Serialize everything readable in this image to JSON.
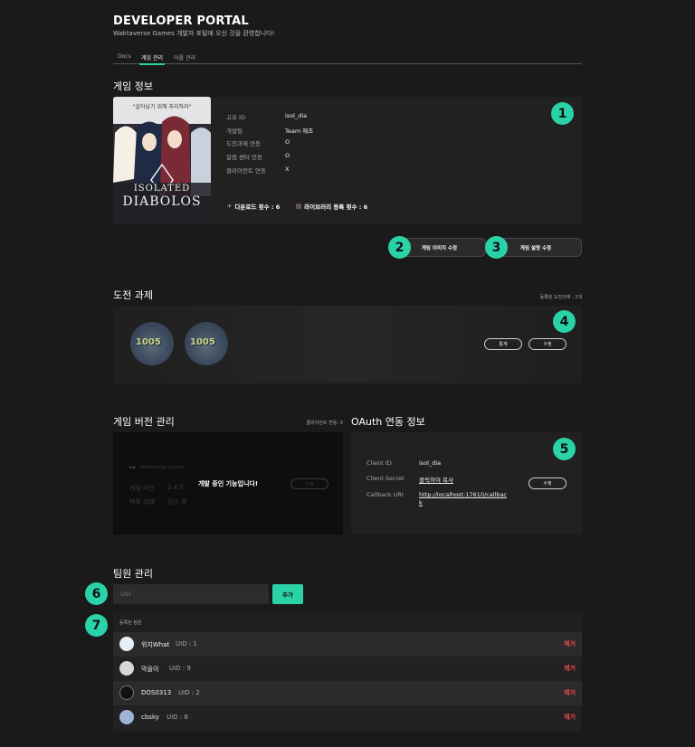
{
  "header": {
    "title": "DEVELOPER PORTAL",
    "subtitle": "Waktaverse Games 개발자 포털에 오신 것을 환영합니다!"
  },
  "tabs": [
    {
      "label": "Docs"
    },
    {
      "label": "게임 관리",
      "active": true
    },
    {
      "label": "어플 관리"
    }
  ],
  "game_info": {
    "title": "게임 정보",
    "cover": {
      "tagline": "\"살아남기 위해 추리하라\"",
      "logo_line1": "ISOLATED",
      "logo_line2": "DIABOLOS"
    },
    "rows": [
      {
        "label": "고유 ID",
        "value": "isol_dia"
      },
      {
        "label": "개발팀",
        "value": "Team 해조"
      },
      {
        "label": "도전과제 연동",
        "value": "O"
      },
      {
        "label": "알림 센터 연동",
        "value": "O"
      },
      {
        "label": "클라이언트 연동",
        "value": "X"
      }
    ],
    "downloads": "다운로드 횟수 : 6",
    "library": "라이브러리 등록 횟수 : 6",
    "edit_image_button": "게임 이미지 수정",
    "edit_desc_button": "게임 설명 수정"
  },
  "badges": [
    "1",
    "2",
    "3",
    "4",
    "5",
    "6",
    "7"
  ],
  "achievements": {
    "title": "도전 과제",
    "count_text": "등록된 도전과제 : 2개",
    "coin_labels": [
      "1005",
      "1005"
    ],
    "stats_button": "통계",
    "edit_button": "수정"
  },
  "versions": {
    "title": "게임 버전 관리",
    "client_status": "클라이언트 연동: X",
    "overlay_text": "개발 중인 기능입니다!",
    "brand": "Waktaverse Games",
    "version_label": "게임 버전",
    "version_value": "2.4.5",
    "status_label": "배포 상태",
    "status_value": "검수 중",
    "edit_button": "수정"
  },
  "oauth": {
    "title": "OAuth 연동 정보",
    "client_id_label": "Client ID",
    "client_id": "isol_dia",
    "secret_label": "Client Secret",
    "secret_value": "클릭하여 복사",
    "callback_label": "Callback URI",
    "callback_line1": "http://localhost:17610/callbac",
    "callback_line2": "k",
    "edit_button": "수정"
  },
  "team": {
    "title": "팀원 관리",
    "uid_placeholder": "UID",
    "add_button": "추가",
    "registered_title": "등록된 팀원",
    "members": [
      {
        "name": "워지What",
        "uid": "UID : 1",
        "remove": "제거"
      },
      {
        "name": "막을이",
        "uid": "UID : 9",
        "remove": "제거"
      },
      {
        "name": "DOS0313",
        "uid": "UID : 2",
        "remove": "제거"
      },
      {
        "name": "cbsky",
        "uid": "UID : 8",
        "remove": "제거"
      }
    ]
  },
  "colors": {
    "accent": "#2ad2a8",
    "danger": "#e84a4a",
    "background": "#1a1a1a",
    "panel": "#212121"
  }
}
